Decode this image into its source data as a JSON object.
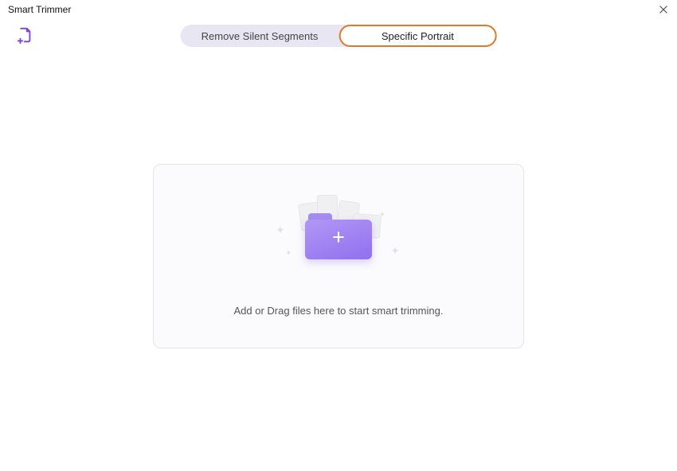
{
  "title": "Smart Trimmer",
  "tabs": {
    "remove_silent": "Remove Silent Segments",
    "specific_portrait": "Specific Portrait"
  },
  "dropzone": {
    "prompt": "Add or Drag files here to start smart trimming."
  }
}
